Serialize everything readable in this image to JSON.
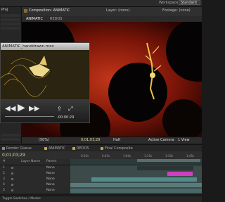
{
  "menubar": {
    "workspace_label": "Workspace:",
    "workspace_value": "Standard"
  },
  "project": {
    "tab": "Proj"
  },
  "viewer": {
    "comp_title": "Composition: ANIMATIC",
    "layer_title": "Layer: (none)",
    "footage_title": "Footage: (none)",
    "tabs": [
      "ANIMATIC",
      "REDOS"
    ],
    "zoom": "(50%)",
    "timecode": "0;01;03;29",
    "resolution": "Half",
    "camera": "Active Camera",
    "views": "1 View"
  },
  "quicktime": {
    "title": "ANIMATIC_handdrawn.mov",
    "timecode": "-00:00:29"
  },
  "timeline": {
    "tabs": [
      "Render Queue",
      "ANIMATIC",
      "REDOS",
      "Final Composite"
    ],
    "timecode": "0;01;03;29",
    "ticks": [
      "0:30s",
      "0:45s",
      "1:00s",
      "1:15s",
      "1:30s",
      "1:45s"
    ],
    "col_num": "#",
    "col_name": "Layer Name",
    "col_parent": "Parent",
    "layers": [
      {
        "num": "1",
        "parent": "None"
      },
      {
        "num": "2",
        "parent": "None"
      },
      {
        "num": "3",
        "parent": "None"
      },
      {
        "num": "4",
        "parent": "None"
      },
      {
        "num": "5",
        "parent": "None"
      }
    ],
    "footer": "Toggle Switches / Modes"
  },
  "colors": {
    "comp_bg": "#5a0d05",
    "accent_pink": "#d13fbf",
    "accent_green": "#4ec94a",
    "accent_yellow": "#d9c34a"
  }
}
